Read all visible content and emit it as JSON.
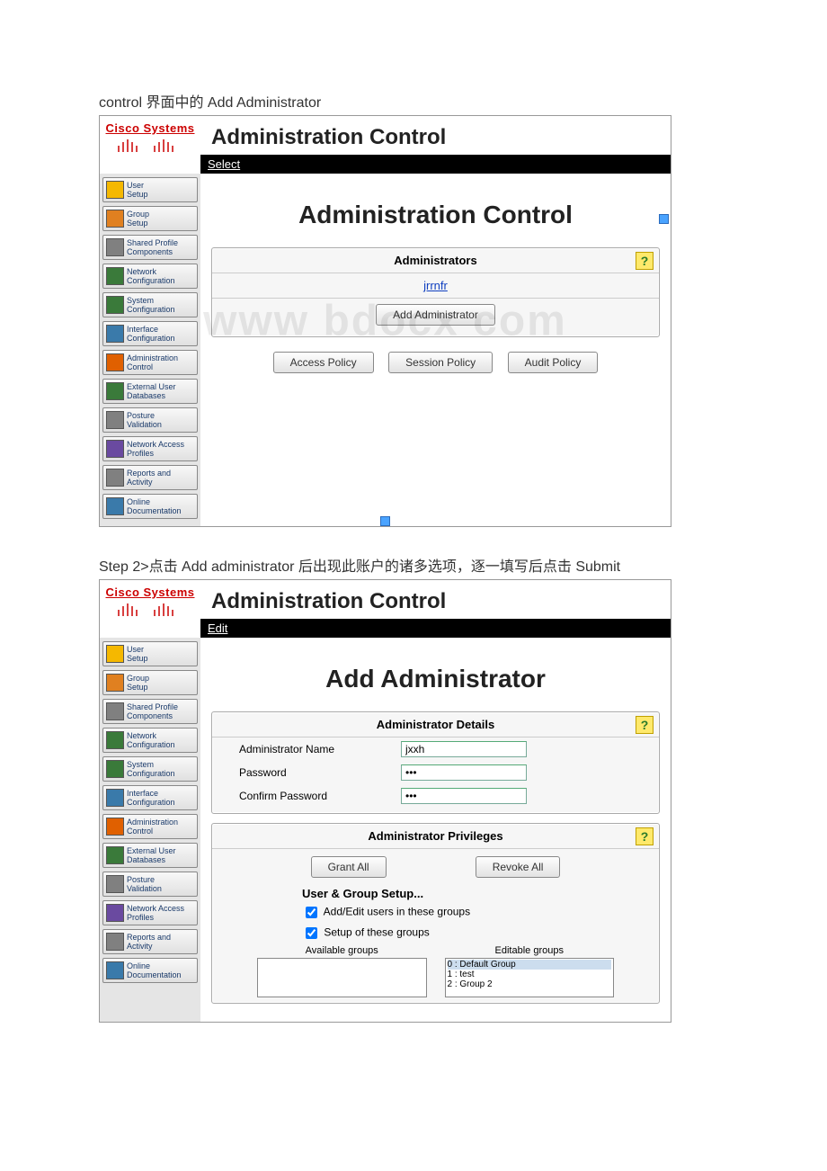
{
  "doc": {
    "line1": "control 界面中的 Add Administrator",
    "line2": "Step 2>点击 Add administrator 后出现此账户的诸多选项，逐一填写后点击 Submit"
  },
  "logo": "Cisco Systems",
  "app_title": "Administration Control",
  "bar1": "Select",
  "bar2": "Edit",
  "nav": [
    "User\nSetup",
    "Group\nSetup",
    "Shared Profile\nComponents",
    "Network\nConfiguration",
    "System\nConfiguration",
    "Interface\nConfiguration",
    "Administration\nControl",
    "External User\nDatabases",
    "Posture\nValidation",
    "Network Access\nProfiles",
    "Reports and\nActivity",
    "Online\nDocumentation"
  ],
  "screen1": {
    "heading": "Administration Control",
    "panel_title": "Administrators",
    "admin_link": "jrrnfr",
    "add_btn": "Add Administrator",
    "policy_btns": [
      "Access Policy",
      "Session Policy",
      "Audit Policy"
    ]
  },
  "screen2": {
    "heading": "Add Administrator",
    "details_title": "Administrator Details",
    "name_label": "Administrator Name",
    "name_value": "jxxh",
    "pw_label": "Password",
    "pw_value": "•••",
    "cpw_label": "Confirm Password",
    "cpw_value": "•••",
    "priv_title": "Administrator Privileges",
    "grant_btn": "Grant All",
    "revoke_btn": "Revoke All",
    "section_heading": "User & Group Setup...",
    "cb1": "Add/Edit users in these groups",
    "cb2": "Setup of these groups",
    "avail_label": "Available groups",
    "edit_label": "Editable groups",
    "groups": [
      "0 : Default Group",
      "1 : test",
      "2 : Group 2"
    ]
  },
  "watermark": "www bdocx com"
}
